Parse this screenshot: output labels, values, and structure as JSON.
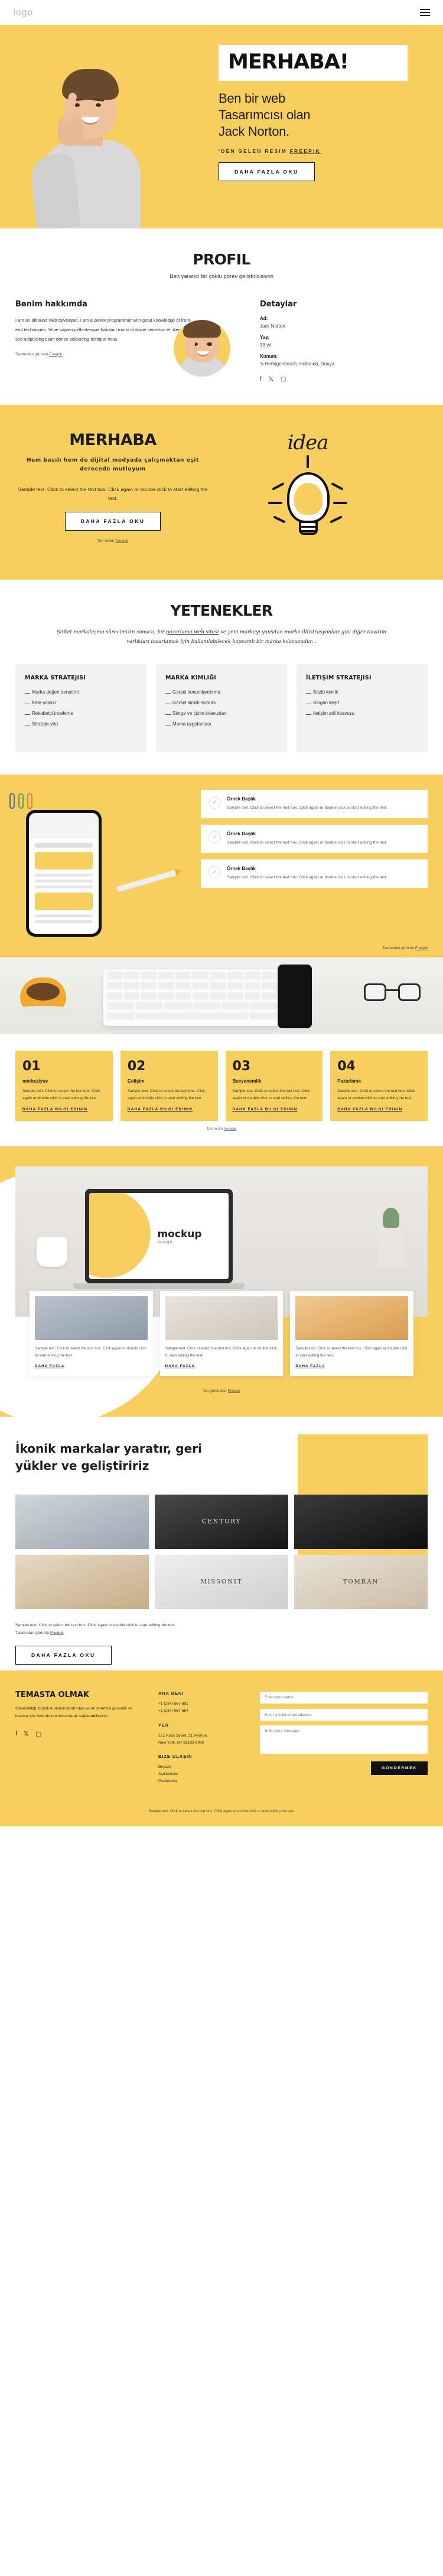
{
  "topbar": {
    "logo": "logo",
    "menu_icon": "hamburger-menu-icon"
  },
  "hero": {
    "heading": "MERHABA!",
    "subtitle_line1": "Ben bir web",
    "subtitle_line2": "Tasarımcısı olan",
    "subtitle_line3": "Jack Norton.",
    "credit_prefix": "'DEN GELEN RESIM",
    "credit_link": "FREEPIK",
    "cta": "DAHA FAZLA OKU"
  },
  "profile": {
    "title": "PROFIL",
    "subtitle": "Ben yaratıcı bir çoklu görev geliştiricisiyim",
    "about_title": "Benim hakkımda",
    "about_text": "I am an allround web developer. I am a senior programmer with good knowledge of front-end techniques. Vitae sapien pellentesque habitant morbi tristique senectus et. Aenean sed adipiscing diam donec adipiscing tristique risus.",
    "about_credit_prefix": "Tarafından görüntü",
    "about_credit_link": "Freepik",
    "details_title": "Detaylar",
    "details": [
      {
        "label": "Ad:",
        "value": "Jack Norton"
      },
      {
        "label": "Yaş:",
        "value": "33 yıl"
      },
      {
        "label": "Konum:",
        "value": "'s-Hertogenbosch, Hollanda, Dünya"
      }
    ],
    "socials": [
      "facebook-icon",
      "twitter-icon",
      "instagram-icon"
    ]
  },
  "merhaba": {
    "heading": "MERHABA",
    "tagline": "Hem basılı hem de dijital medyada çalışmaktan eşit derecede mutluyum",
    "body": "Sample text. Click to select the text box. Click again or double click to start editing the text.",
    "cta": "DAHA FAZLA OKU",
    "credit_prefix": "Tan resim",
    "credit_link": "Freepik",
    "idea_word": "idea"
  },
  "skills": {
    "title": "YETENEKLER",
    "intro_part1": "Şirket markalaşma sürecimizin sonucu, bir ",
    "intro_link": "pazarlama web sitesi",
    "intro_part2": " ve yeni markayı yansıtan marka illüstrasyonları gibi diğer tasarım varlıkları tasarlamak için kullanılabilecek kapsamlı bir marka kılavuzudur. .",
    "columns": [
      {
        "title": "MARKA STRATEJISI",
        "items": [
          "Marka değeri denetimi",
          "Kitle analizi",
          "Rekabetçi inceleme",
          "Stratejik yön"
        ]
      },
      {
        "title": "MARKA KIMLIĞI",
        "items": [
          "Görsel konumlandırma",
          "Görsel kimlik sistemi",
          "Simge ve çizim kılavuzları",
          "Marka uygulaması"
        ]
      },
      {
        "title": "İLETIŞIM STRATEJISI",
        "items": [
          "Sözlü kimlik",
          "Slogan keşif",
          "İletişim stili kılavuzu"
        ]
      }
    ]
  },
  "features": {
    "items": [
      {
        "icon": "check-circle-icon",
        "title": "Örnek Başlık",
        "text": "Sample text. Click to select the text box. Click again or double click to start editing the text."
      },
      {
        "icon": "check-circle-icon",
        "title": "Örnek Başlık",
        "text": "Sample text. Click to select the text box. Click again or double click to start editing the text."
      },
      {
        "icon": "check-circle-icon",
        "title": "Örnek Başlık",
        "text": "Sample text. Click to select the text box. Click again or double click to start editing the text."
      }
    ],
    "credit_prefix": "Tarafından görüntü",
    "credit_link": "Freepik"
  },
  "numbered_cards": {
    "items": [
      {
        "num": "01",
        "title": "merkeziyse",
        "text": "Sample text. Click to select the text box. Click again or double click to start editing the text.",
        "link": "DAHA FAZLA BILGI EDININ"
      },
      {
        "num": "02",
        "title": "Gelişim",
        "text": "Sample text. Click to select the text box. Click again or double click to start editing the text.",
        "link": "DAHA FAZLA BILGI EDININ"
      },
      {
        "num": "03",
        "title": "Bseyenemlik",
        "text": "Sample text. Click to select the text box. Click again or double click to start editing the text.",
        "link": "DAHA FAZLA BILGI EDININ"
      },
      {
        "num": "04",
        "title": "Pazarlama",
        "text": "Sample text. Click to select the text box. Click again or double click to start editing the text.",
        "link": "DAHA FAZLA BILGI EDININ"
      }
    ],
    "credit_prefix": "Tan resim",
    "credit_link": "Freepik"
  },
  "mockup": {
    "screen_title": "mockup",
    "screen_sub": "design.",
    "thumbs": [
      {
        "text": "Sample text. Click to select the text box. Click again or double click to start editing the text.",
        "link": "DAHA FAZLA"
      },
      {
        "text": "Sample text. Click to select the text box. Click again or double click to start editing the text.",
        "link": "DAHA FAZLA"
      },
      {
        "text": "Sample text. Click to select the text box. Click again or double click to start editing the text.",
        "link": "DAHA FAZLA"
      }
    ],
    "credit_prefix": "Tan görüntüler",
    "credit_link": "Freepik"
  },
  "brands": {
    "heading": "İkonik markalar yaratır, geri yükler ve geliştiririz",
    "images": [
      {
        "label": ""
      },
      {
        "label": "CENTURY"
      },
      {
        "label": ""
      },
      {
        "label": ""
      },
      {
        "label": "MISSONIT"
      },
      {
        "label": "TOMRAN"
      }
    ],
    "body": "Sample text. Click to select the text box. Click again or double click to start editing the text.",
    "credit_prefix": "Tarafından görüntü",
    "credit_link": "Freepik",
    "cta": "DAHA FAZLA OKU"
  },
  "contact": {
    "title": "TEMASTA OLMAK",
    "body": "Güvenilirliği, büyük mutluluk tarafından ve en önemlisi güvenilir ve başlıca göz önünde bulundurularak sağlanabilirsiniz.",
    "col2": [
      {
        "heading": "ARA BENI",
        "lines": [
          "+1 (234) 567-891",
          "+1 (234) 987-654"
        ]
      },
      {
        "heading": "YER",
        "lines": [
          "121 Rock Street, 21 Avenue,",
          "New York, NY 92103-9000"
        ]
      },
      {
        "heading": "BIZE ULAŞIN",
        "lines": [
          "Beyazıt",
          "Açıklamalar",
          "Pazarlama"
        ]
      }
    ],
    "name_placeholder": "Enter your name",
    "email_placeholder": "Enter a valid email address",
    "message_placeholder": "Enter your message",
    "send_label": "GÖNDERMEK",
    "socials": [
      "facebook-icon",
      "twitter-icon",
      "instagram-icon"
    ]
  },
  "footer": {
    "note": "Sample text. Click to select the text box. Click again or double click to start editing the text."
  }
}
